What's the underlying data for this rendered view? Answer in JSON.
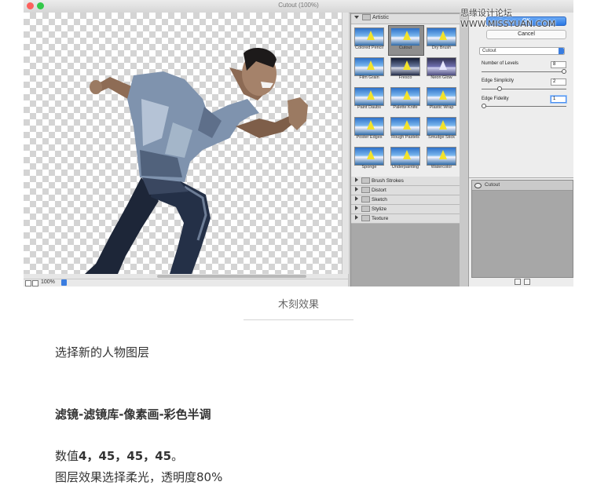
{
  "watermark": "思缘设计论坛 WWW.MISSYUAN.COM",
  "window": {
    "title": "Cutout (100%)",
    "zoom": "100%"
  },
  "gallery": {
    "category_open": "Artistic",
    "thumbnails": [
      "Colored Pencil",
      "Cutout",
      "Dry Brush",
      "Film Grain",
      "Fresco",
      "Neon Glow",
      "Paint Daubs",
      "Palette Knife",
      "Plastic Wrap",
      "Poster Edges",
      "Rough Pastels",
      "Smudge Stick",
      "Sponge",
      "Underpainting",
      "Watercolor"
    ],
    "selected": "Cutout",
    "categories_closed": [
      "Brush Strokes",
      "Distort",
      "Sketch",
      "Stylize",
      "Texture"
    ]
  },
  "settings": {
    "ok_label": "OK",
    "cancel_label": "Cancel",
    "filter": "Cutout",
    "params": [
      {
        "label": "Number of Levels",
        "value": "8",
        "level": 1.0
      },
      {
        "label": "Edge Simplicity",
        "value": "2",
        "level": 0.2
      },
      {
        "label": "Edge Fidelity",
        "value": "1",
        "level": 0.0
      }
    ],
    "layer_name": "Cutout"
  },
  "article": {
    "caption": "木刻效果",
    "p1": "选择新的人物图层",
    "p2": "滤镜-滤镜库-像素画-彩色半调",
    "p3_prefix": "数值",
    "p3_values": "4，45，45，45",
    "p3_suffix": "。",
    "p4": "图层效果选择柔光，透明度80%"
  },
  "colors": {
    "accent": "#2a78e4",
    "panel": "#ededed",
    "dark_panel": "#a8a8a8"
  }
}
